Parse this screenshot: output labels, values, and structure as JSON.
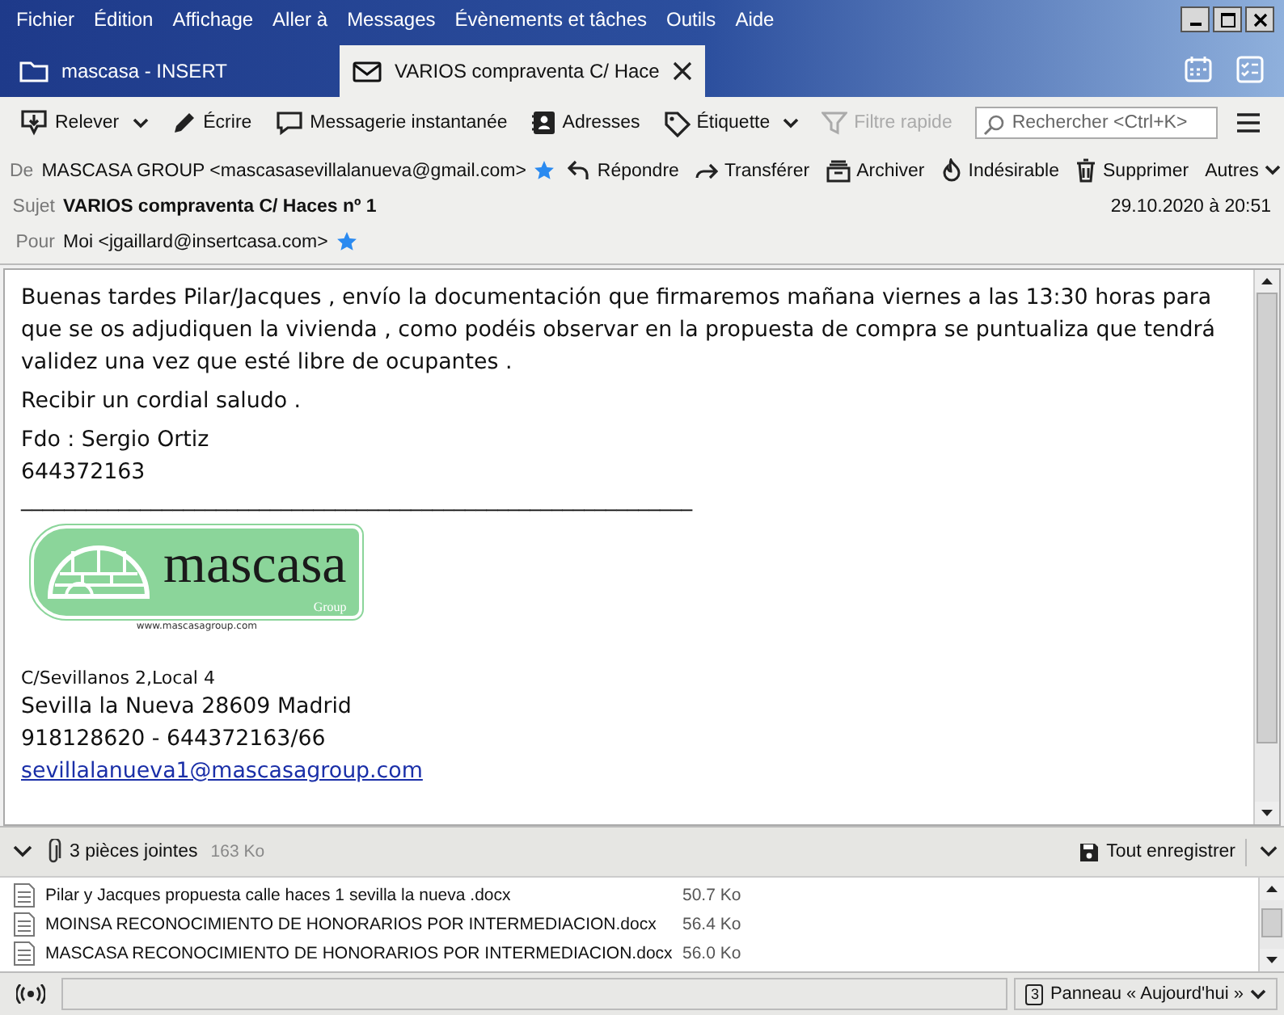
{
  "menu": [
    "Fichier",
    "Édition",
    "Affichage",
    "Aller à",
    "Messages",
    "Évènements et tâches",
    "Outils",
    "Aide"
  ],
  "tabs": [
    {
      "label": "mascasa - INSERT",
      "kind": "folder",
      "selected": false
    },
    {
      "label": "VARIOS compraventa C/ Hace",
      "kind": "mail",
      "selected": true
    }
  ],
  "toolbar": {
    "buttons": [
      {
        "label": "Relever",
        "kind": "get",
        "disabled": false
      },
      {
        "label": "Écrire",
        "kind": "write",
        "disabled": false
      },
      {
        "label": "Messagerie instantanée",
        "kind": "chat",
        "disabled": false
      },
      {
        "label": "Adresses",
        "kind": "contacts",
        "disabled": false
      },
      {
        "label": "Étiquette",
        "kind": "tag",
        "disabled": false
      },
      {
        "label": "Filtre rapide",
        "kind": "filter",
        "disabled": true
      }
    ],
    "search": {
      "placeholder": "Rechercher <Ctrl+K>"
    }
  },
  "header": {
    "from_label": "De",
    "from": "MASCASA GROUP <mascasasevillalanueva@gmail.com>",
    "actions": [
      {
        "label": "Répondre",
        "kind": "reply"
      },
      {
        "label": "Transférer",
        "kind": "forward"
      },
      {
        "label": "Archiver",
        "kind": "archive"
      },
      {
        "label": "Indésirable",
        "kind": "junk"
      },
      {
        "label": "Supprimer",
        "kind": "delete"
      },
      {
        "label": "Autres",
        "kind": "more"
      }
    ],
    "subject_label": "Sujet",
    "subject": "VARIOS compraventa C/ Haces nº 1",
    "date": "29.10.2020 à 20:51",
    "to_label": "Pour",
    "to": "Moi <jgaillard@insertcasa.com>"
  },
  "body": {
    "paragraphs": [
      "Buenas tardes Pilar/Jacques , envío la documentación que firmaremos mañana viernes a las 13:30 horas para que se os adjudiquen la vivienda , como podéis observar  en la propuesta de compra se puntualiza que tendrá validez  una vez que esté libre de ocupantes .",
      "Recibir un cordial saludo ."
    ],
    "signature": [
      "Fdo : Sergio Ortiz",
      "644372163"
    ],
    "rule": "______________________________________________________________",
    "logo": {
      "name": "mascasa",
      "tagline": "Group",
      "url": "www.mascasagroup.com"
    },
    "address_small": "C/Sevillanos 2,Local 4",
    "address": [
      "Sevilla la Nueva 28609 Madrid",
      "918128620 - 644372163/66"
    ],
    "email": "sevillalanueva1@mascasagroup.com"
  },
  "attachments": {
    "count": "3 pièces jointes",
    "size": "163 Ko",
    "save_all": "Tout enregistrer",
    "items": [
      {
        "name": "Pilar y Jacques propuesta calle haces 1 sevilla la nueva .docx",
        "size": "50.7 Ko"
      },
      {
        "name": "MOINSA RECONOCIMIENTO DE HONORARIOS POR INTERMEDIACION.docx",
        "size": "56.4 Ko"
      },
      {
        "name": "MASCASA RECONOCIMIENTO DE HONORARIOS POR INTERMEDIACION.docx",
        "size": "56.0 Ko"
      }
    ]
  },
  "status_bar": {
    "panel": "Panneau « Aujourd'hui »",
    "calendar_day": "3"
  }
}
